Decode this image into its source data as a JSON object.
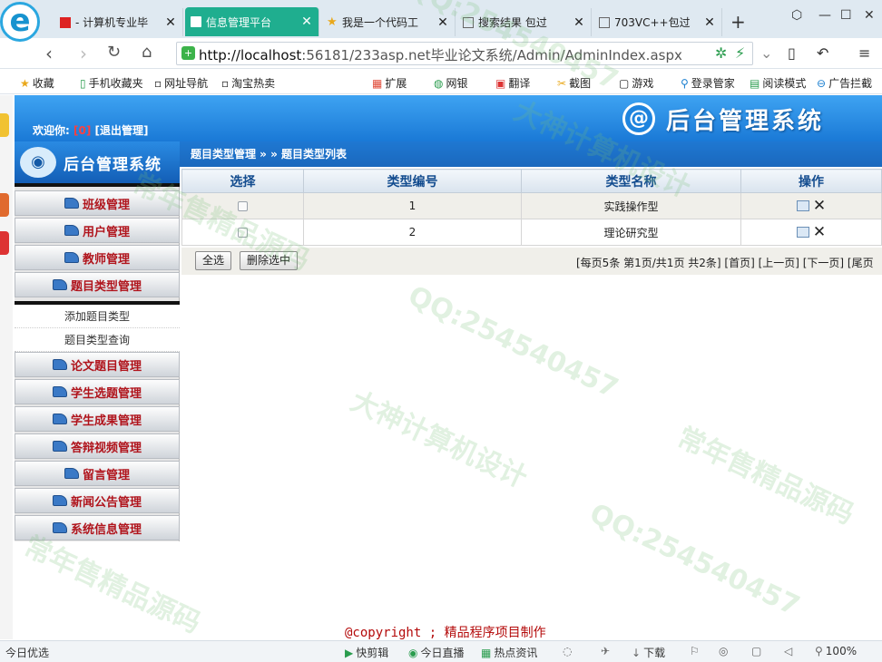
{
  "browser": {
    "tabs": [
      {
        "title": "- 计算机专业毕",
        "icon": "site-favicon-icon",
        "active": false
      },
      {
        "title": "信息管理平台",
        "icon": "document-icon",
        "active": true
      },
      {
        "title": "我是一个代码工",
        "icon": "star-icon",
        "active": false
      },
      {
        "title": "搜索结果 包过",
        "icon": "document-icon",
        "active": false
      },
      {
        "title": "703VC++包过",
        "icon": "document-icon",
        "active": false
      }
    ],
    "url_host": "http://localhost",
    "url_rest": ":56181/233asp.net毕业论文系统/Admin/AdminIndex.aspx",
    "bookmarks": [
      "收藏",
      "手机收藏夹",
      "网址导航",
      "淘宝热卖",
      "扩展",
      "网银",
      "翻译",
      "截图",
      "游戏",
      "登录管家",
      "阅读模式",
      "广告拦截"
    ]
  },
  "header": {
    "welcome_label": "欢迎你:",
    "user": "[0]",
    "logout": "[退出管理]",
    "brand_glyph": "@",
    "brand": "后台管理系统"
  },
  "sidebar": {
    "brand": "后台管理系统",
    "menu_top": [
      "班级管理",
      "用户管理",
      "教师管理",
      "题目类型管理"
    ],
    "sub_items": [
      "添加题目类型",
      "题目类型查询"
    ],
    "menu_bottom": [
      "论文题目管理",
      "学生选题管理",
      "学生成果管理",
      "答辩视频管理",
      "留言管理",
      "新闻公告管理",
      "系统信息管理"
    ]
  },
  "main": {
    "breadcrumb": "题目类型管理 » » 题目类型列表",
    "columns": [
      "选择",
      "类型编号",
      "类型名称",
      "操作"
    ],
    "rows": [
      {
        "id": "1",
        "name": "实践操作型"
      },
      {
        "id": "2",
        "name": "理论研究型"
      }
    ],
    "select_all": "全选",
    "delete_selected": "删除选中",
    "pager": "[每页5条 第1页/共1页 共2条] [首页] [上一页] [下一页] [尾页"
  },
  "footer": "@copyright ; 精品程序项目制作",
  "statusbar": [
    "今日优选",
    "快剪辑",
    "今日直播",
    "热点资讯",
    "下载",
    "100%"
  ],
  "watermarks": [
    "QQ:254540457",
    "大神计算机设计",
    "常年售精品源码"
  ]
}
